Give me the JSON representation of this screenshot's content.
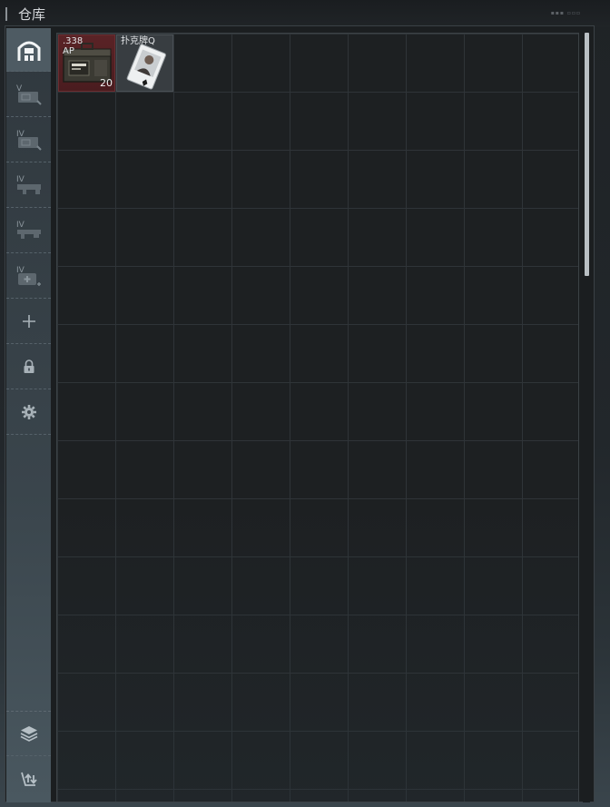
{
  "header": {
    "title": "仓库",
    "status_text": "▪▪▪ ▫▫▫"
  },
  "sidebar": {
    "buttons": [
      {
        "name": "stash-icon",
        "roman": ""
      },
      {
        "name": "container-v-icon",
        "roman": "V"
      },
      {
        "name": "container-iv-icon",
        "roman": "IV"
      },
      {
        "name": "weapon-case-iv-icon",
        "roman": "IV"
      },
      {
        "name": "weapon-case-iv-icon-2",
        "roman": "IV"
      },
      {
        "name": "medical-case-iv-icon",
        "roman": "IV"
      },
      {
        "name": "add-icon",
        "roman": ""
      },
      {
        "name": "lock-icon",
        "roman": ""
      },
      {
        "name": "gear-icon",
        "roman": ""
      },
      {
        "name": "layers-icon",
        "roman": ""
      },
      {
        "name": "transfer-icon",
        "roman": ""
      }
    ]
  },
  "grid": {
    "columns": 9,
    "rows": 14
  },
  "items": [
    {
      "name": ".338",
      "sub": "AP",
      "count": "20",
      "icon": "ammo-box-icon",
      "color": "#5a2326"
    },
    {
      "name": "扑克牌Q",
      "sub": "",
      "count": "",
      "icon": "playing-card-icon",
      "color": "#383d41"
    }
  ],
  "colors": {
    "accent": "#b9bfc3",
    "ammo_bg": "#5a2326",
    "grid_bg": "#1d2022"
  }
}
